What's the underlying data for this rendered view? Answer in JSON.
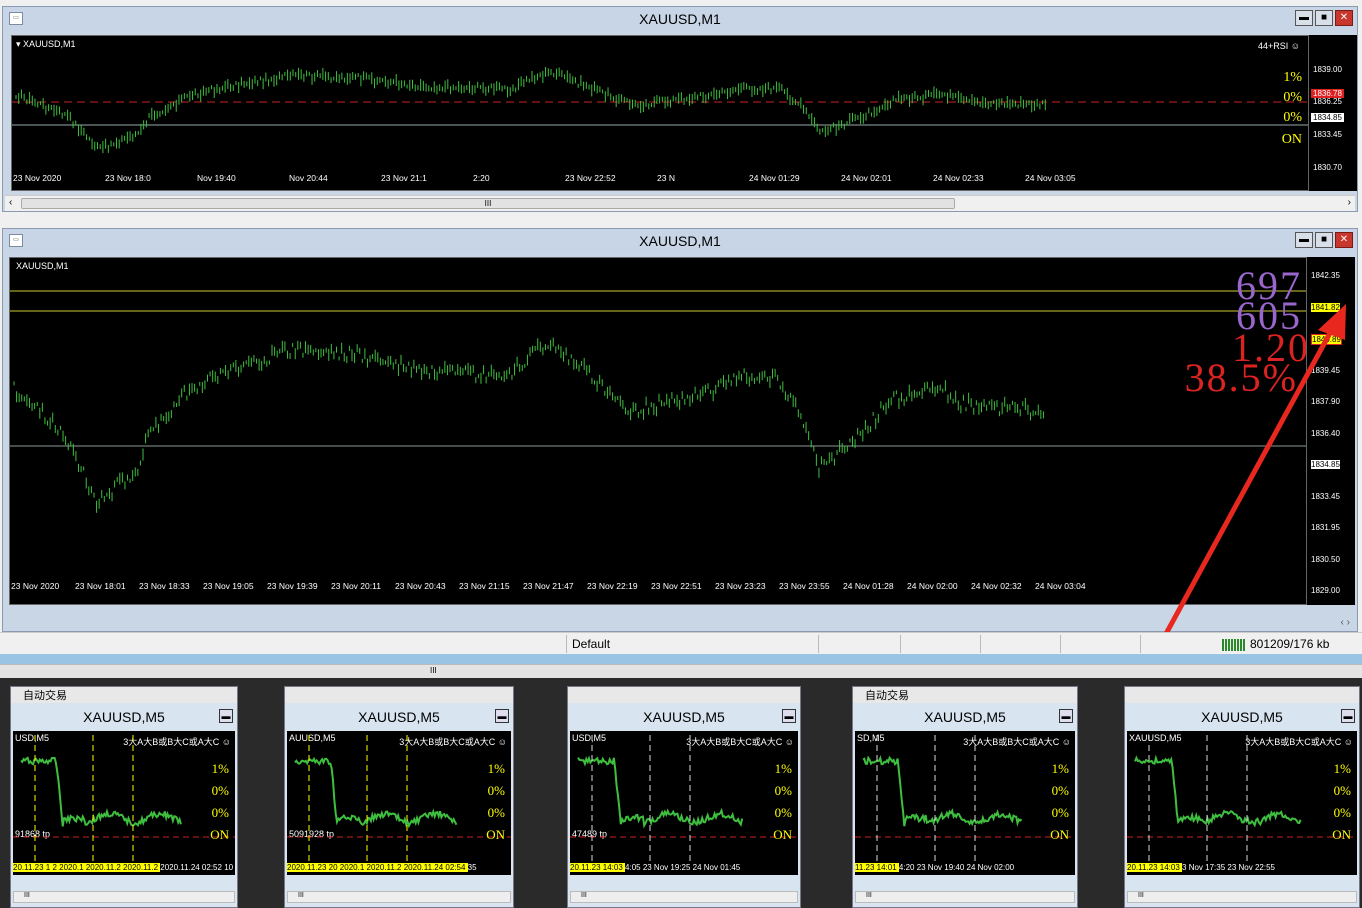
{
  "win1": {
    "title": "XAUUSD,M1",
    "chart_label": "XAUUSD,M1",
    "indicator_label": "44+RSI",
    "prices": [
      "1839.00",
      "1836.25",
      "1834.85",
      "1833.45",
      "1830.70"
    ],
    "current_price": "1834.85",
    "red_price": "1836.78",
    "pcts": [
      "1%",
      "0%",
      "0%",
      "ON"
    ],
    "xticks": [
      "23 Nov 2020",
      "23 Nov 18:0",
      "Nov 19:40",
      "Nov 20:44",
      "23 Nov 21:1",
      "2:20",
      "23 Nov 22:52",
      "23 N",
      "24 Nov 01:29",
      "24 Nov 02:01",
      "24 Nov 02:33",
      "24 Nov 03:05"
    ]
  },
  "win2": {
    "title": "XAUUSD,M1",
    "chart_label": "XAUUSD,M1",
    "prices": [
      "1842.35",
      "1841.82",
      "1840.89",
      "1839.45",
      "1837.90",
      "1836.40",
      "1834.85",
      "1833.45",
      "1831.95",
      "1830.50",
      "1829.00"
    ],
    "big": [
      "697",
      "605",
      "1.20",
      "38.5%"
    ],
    "xticks": [
      "23 Nov 2020",
      "23 Nov 18:01",
      "23 Nov 18:33",
      "23 Nov 19:05",
      "23 Nov 19:39",
      "23 Nov 20:11",
      "23 Nov 20:43",
      "23 Nov 21:15",
      "23 Nov 21:47",
      "23 Nov 22:19",
      "23 Nov 22:51",
      "23 Nov 23:23",
      "23 Nov 23:55",
      "24 Nov 01:28",
      "24 Nov 02:00",
      "24 Nov 02:32",
      "24 Nov 03:04"
    ]
  },
  "status": {
    "profile": "Default",
    "traffic": "801209/176 kb"
  },
  "minis": [
    {
      "title": "XAUUSD,M5",
      "label": "USD,M5",
      "ind": "3大A大B或B大C或A大C",
      "tp": "91868 tp",
      "dates": [
        "20.11.23",
        "1 2",
        "2020.1",
        "2020.11.2",
        "2020.11.2",
        "2020.11.24 02:52",
        "10"
      ],
      "toolbar": "自动交易"
    },
    {
      "title": "XAUUSD,M5",
      "label": "AUUSD,M5",
      "ind": "3大A大B或B大C或A大C",
      "tp": "5091928 tp",
      "dates": [
        "2020.11.23",
        "20",
        "2020.1",
        "2020.11.2",
        "2020.11.24 02:54",
        "35"
      ],
      "toolbar": ""
    },
    {
      "title": "XAUUSD,M5",
      "label": "USD,M5",
      "ind": "3大A大B或B大C或A大C",
      "tp": "47489 tp",
      "dates": [
        "20.11.23 14:03",
        "4:05",
        "23 Nov 19:25",
        "24 Nov 01:45"
      ],
      "toolbar": ""
    },
    {
      "title": "XAUUSD,M5",
      "label": "SD,M5",
      "ind": "3大A大B或B大C或A大C",
      "tp": "",
      "dates": [
        "11.23 14:01",
        "4:20",
        "23 Nov 19:40",
        "24 Nov 02:00"
      ],
      "toolbar": "自动交易"
    },
    {
      "title": "XAUUSD,M5",
      "label": "XAUUSD,M5",
      "ind": "3大A大B或B大C或A大C",
      "tp": "",
      "dates": [
        "20.11.23 14:03",
        "3 Nov 17:35",
        "23 Nov 22:55"
      ],
      "toolbar": ""
    }
  ],
  "colors": {
    "candle": "#3fbf3f",
    "yellow": "#ffff00",
    "purple": "#9966cc",
    "red": "#dd2222"
  }
}
